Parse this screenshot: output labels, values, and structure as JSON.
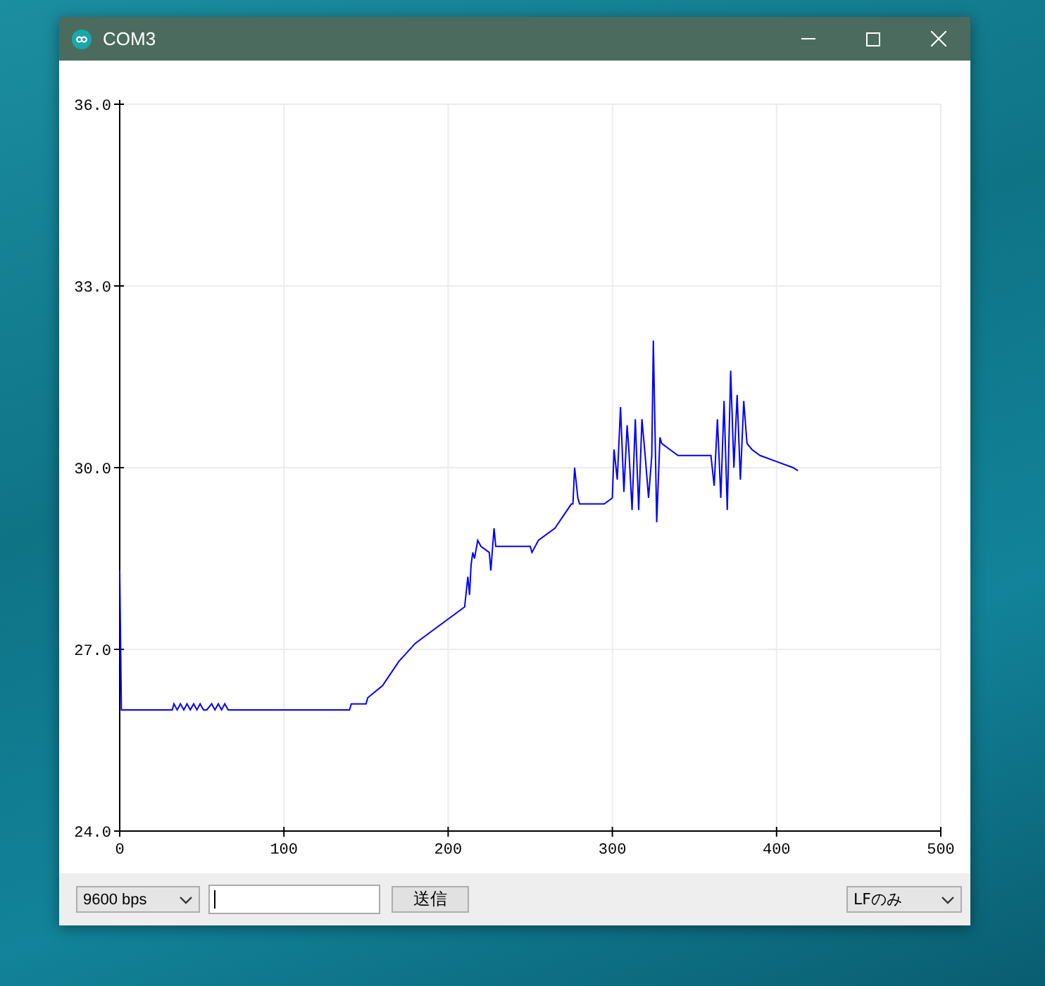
{
  "window": {
    "title": "COM3"
  },
  "plot": {
    "chart_data": {
      "type": "line",
      "x": [
        0,
        1,
        32,
        33,
        35,
        37,
        39,
        41,
        43,
        45,
        47,
        49,
        51,
        53,
        56,
        58,
        60,
        62,
        64,
        66,
        140,
        141,
        150,
        151,
        160,
        170,
        180,
        190,
        200,
        210,
        212,
        213,
        214,
        215,
        216,
        218,
        220,
        225,
        226,
        228,
        229,
        230,
        250,
        251,
        255,
        265,
        275,
        276,
        277,
        279,
        280,
        295,
        300,
        301,
        303,
        305,
        307,
        309,
        310,
        312,
        314,
        316,
        318,
        320,
        322,
        324,
        325,
        327,
        329,
        330,
        335,
        340,
        360,
        362,
        364,
        366,
        368,
        370,
        372,
        374,
        376,
        378,
        380,
        382,
        385,
        390,
        400,
        410,
        413
      ],
      "values": [
        28.3,
        26.0,
        26.0,
        26.1,
        26.0,
        26.1,
        26.0,
        26.1,
        26.0,
        26.1,
        26.0,
        26.1,
        26.0,
        26.0,
        26.1,
        26.0,
        26.1,
        26.0,
        26.1,
        26.0,
        26.0,
        26.1,
        26.1,
        26.2,
        26.4,
        26.8,
        27.1,
        27.3,
        27.5,
        27.7,
        28.2,
        27.9,
        28.4,
        28.6,
        28.5,
        28.8,
        28.7,
        28.6,
        28.3,
        29.0,
        28.7,
        28.7,
        28.7,
        28.6,
        28.8,
        29.0,
        29.4,
        29.4,
        30.0,
        29.5,
        29.4,
        29.4,
        29.5,
        30.3,
        29.8,
        31.0,
        29.6,
        30.7,
        30.3,
        29.3,
        30.8,
        29.3,
        30.8,
        30.2,
        29.5,
        30.2,
        32.1,
        29.1,
        30.5,
        30.4,
        30.3,
        30.2,
        30.2,
        29.7,
        30.8,
        29.5,
        31.1,
        29.3,
        31.6,
        30.0,
        31.2,
        29.8,
        31.1,
        30.4,
        30.3,
        30.2,
        30.1,
        30.0,
        29.95
      ],
      "grid": true,
      "xlim": [
        0,
        500
      ],
      "ylim": [
        24,
        36
      ],
      "xticks": [
        0,
        100,
        200,
        300,
        400,
        500
      ],
      "yticks": [
        {
          "value": 24,
          "label": "24.0"
        },
        {
          "value": 27,
          "label": "27.0"
        },
        {
          "value": 30,
          "label": "30.0"
        },
        {
          "value": 33,
          "label": "33.0"
        },
        {
          "value": 36,
          "label": "36.0"
        }
      ]
    }
  },
  "controls": {
    "baud_rate": "9600 bps",
    "send_button": "送信",
    "line_ending": "LFのみ"
  }
}
